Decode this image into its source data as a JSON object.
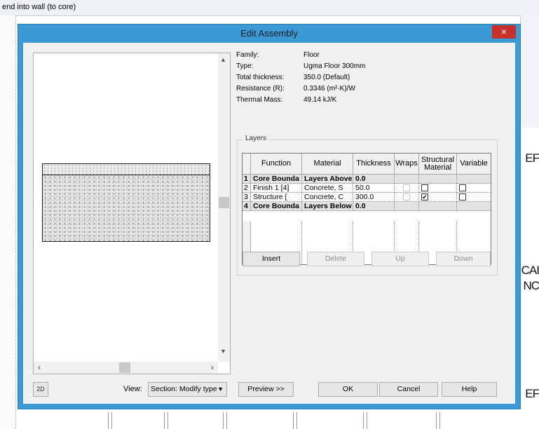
{
  "background": {
    "topbar_text": "end into wall (to core)",
    "right_labels": [
      "EF",
      "CAI",
      "NC",
      "EF"
    ]
  },
  "dialog": {
    "title": "Edit Assembly",
    "close_glyph": "×",
    "properties": [
      {
        "label": "Family:",
        "value": "Floor"
      },
      {
        "label": "Type:",
        "value": "Ugma Floor 300mm"
      },
      {
        "label": "Total thickness:",
        "value": "350.0 (Default)"
      },
      {
        "label": "Resistance (R):",
        "value": "0.3346 (m²·K)/W"
      },
      {
        "label": "Thermal Mass:",
        "value": "49.14 kJ/K"
      }
    ],
    "layers_group_label": "Layers",
    "layers_table": {
      "columns": [
        "",
        "Function",
        "Material",
        "Thickness",
        "Wraps",
        "Structural Material",
        "Variable"
      ],
      "rows": [
        {
          "num": "1",
          "function": "Core Bounda",
          "material": "Layers Above",
          "thickness": "0.0",
          "wraps": null,
          "structural": null,
          "variable": null,
          "bold": true
        },
        {
          "num": "2",
          "function": "Finish 1 [4]",
          "material": "Concrete, S",
          "thickness": "50.0",
          "wraps": false,
          "structural": false,
          "variable": false,
          "bold": false
        },
        {
          "num": "3",
          "function": "Structure [",
          "material": "Concrete, C",
          "thickness": "300.0",
          "wraps": false,
          "structural": true,
          "variable": false,
          "bold": false
        },
        {
          "num": "4",
          "function": "Core Bounda",
          "material": "Layers Below",
          "thickness": "0.0",
          "wraps": null,
          "structural": null,
          "variable": null,
          "bold": true
        }
      ]
    },
    "buttons": {
      "insert": "Insert",
      "delete": "Delete",
      "up": "Up",
      "down": "Down",
      "preview": "Preview >>",
      "ok": "OK",
      "cancel": "Cancel",
      "help": "Help"
    },
    "view": {
      "label": "View:",
      "selected": "Section: Modify type"
    },
    "zoom_glyph": "2D",
    "preview_icons": [
      "scroll-up-arrow",
      "scroll-down-arrow",
      "scroll-left-arrow",
      "scroll-right-arrow",
      "zoom-icon"
    ]
  }
}
